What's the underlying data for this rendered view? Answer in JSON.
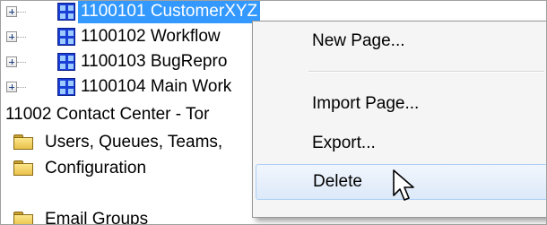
{
  "tree": {
    "nodes": [
      {
        "label": "1100101 CustomerXYZ",
        "icon": "grid-icon",
        "expandable": true,
        "selected": true
      },
      {
        "label": "1100102 Workflow",
        "icon": "grid-icon",
        "expandable": true,
        "selected": false
      },
      {
        "label": "1100103 BugRepro",
        "icon": "grid-icon",
        "expandable": true,
        "selected": false
      },
      {
        "label": "1100104 Main Work",
        "icon": "grid-icon",
        "expandable": true,
        "selected": false
      },
      {
        "label": "11002 Contact Center  - Tor",
        "icon": "",
        "expandable": false,
        "selected": false
      },
      {
        "label": "Users, Queues, Teams,",
        "icon": "folder-icon",
        "expandable": false,
        "selected": false
      },
      {
        "label": "Configuration",
        "icon": "folder-icon",
        "expandable": false,
        "selected": false
      },
      {
        "label": "Email Groups",
        "icon": "folder-icon",
        "expandable": false,
        "selected": false
      }
    ],
    "colors": {
      "selection": "#3399ff",
      "grid_icon": "#1a3fd6",
      "folder": "#f2cf5b"
    }
  },
  "context_menu": {
    "items": [
      {
        "label": "New Page...",
        "hovered": false
      },
      {
        "label": "Import Page...",
        "hovered": false
      },
      {
        "label": "Export...",
        "hovered": false
      },
      {
        "label": "Delete",
        "hovered": true
      }
    ]
  },
  "cursor": {
    "icon": "arrow-pointer-icon"
  }
}
